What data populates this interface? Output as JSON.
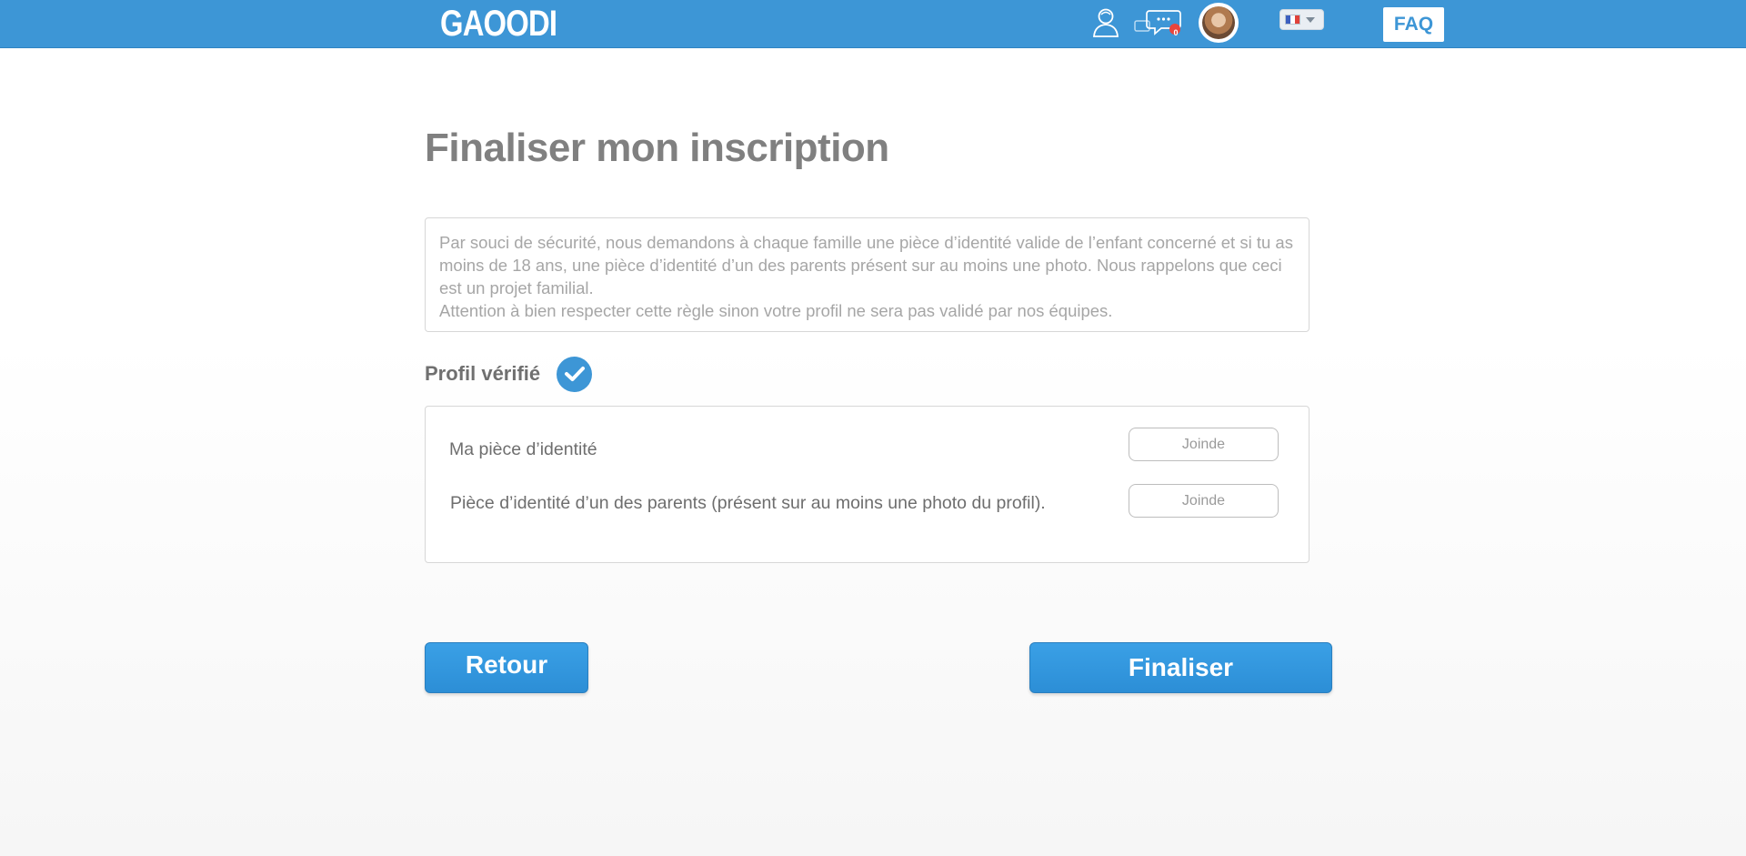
{
  "header": {
    "logo_text": "GAOODI",
    "faq_label": "FAQ",
    "messages_badge_count": "0",
    "icons": [
      "user-icon",
      "messages-icon",
      "avatar",
      "flag-fr-icon",
      "chevron-down-icon"
    ],
    "language_selected": "FR",
    "colors": {
      "bar": "#3d96d6",
      "badge": "#e8453c"
    }
  },
  "main": {
    "title": "Finaliser mon inscription",
    "notice_line1": "Par souci de sécurité, nous demandons à chaque famille une pièce d’identité valide de l’enfant concerné et si tu as moins de 18 ans, une pièce d’identité d’un des parents présent sur au moins une photo. Nous rappelons que ceci est un projet familial.",
    "notice_line2": "Attention à bien respecter cette règle sinon votre profil ne sera pas validé par nos équipes.",
    "verified_label": "Profil vérifié",
    "documents": [
      {
        "label": "Ma pièce d’identité",
        "button": "Joinde"
      },
      {
        "label": "Pièce d’identité d’un des parents (présent sur au moins une photo du profil).",
        "button": "Joinde"
      }
    ],
    "back_label": "Retour",
    "finish_label": "Finaliser"
  }
}
